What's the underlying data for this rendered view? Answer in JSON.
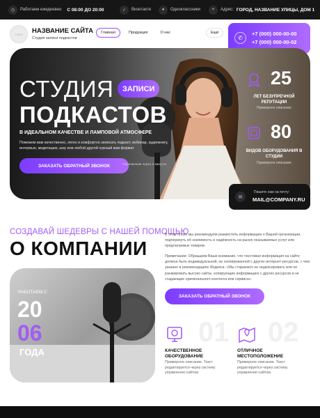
{
  "topbar": {
    "hours_label": "Работаем ежедневно",
    "hours_value": "С 08:00 ДО 20:00",
    "social_1": "Вконтакте",
    "social_2": "Одноклассники",
    "address_label": "Адрес:",
    "address_value": "ГОРОД, НАЗВАНИЕ УЛИЦЫ, ДОМ 1"
  },
  "header": {
    "logo_text": "LOGO",
    "site_title": "НАЗВАНИЕ САЙТА",
    "site_subtitle": "Студия записи подкастов",
    "nav": [
      "Главная",
      "Продукция",
      "О нас"
    ],
    "nav_more": "Ещё",
    "phones": [
      "+7 (000) 000-00-00",
      "+7 (000) 000-00-02"
    ]
  },
  "hero": {
    "title_line1": "СТУДИЯ",
    "title_badge": "ЗАПИСИ",
    "title_line2": "ПОДКАСТОВ",
    "subtitle": "В ИДЕАЛЬНОМ КАЧЕСТВЕ И ЛАМПОВОЙ АТМОСФЕРЕ",
    "description": "Поможем вам качественно, легко и комфортно записать подкаст, вебинар, аудиокнигу, интервью, медитацию, шоу или любой другой нужный вам формат",
    "cta": "ЗАКАЗАТЬ ОБРАТНЫЙ ЗВОНОК",
    "cta_note": "Перезвоним через 2 минуты",
    "stats": [
      {
        "number": "25",
        "title": "ЛЕТ БЕЗУПРЕЧНОЙ\nРЕПУТАЦИИ",
        "desc": "Примерное описание"
      },
      {
        "number": "80",
        "title": "ВИДОВ ОБОРУДОВАНИЯ В\nСТУДИИ",
        "desc": "Примерное описание"
      }
    ],
    "mail_label": "Пишите нам на почту:",
    "mail_value": "MAIL@COMPANY.RU"
  },
  "about": {
    "kicker": "СОЗДАВАЙ ШЕДЕВРЫ С НАШЕЙ ПОМОЩЬЮ",
    "title": "О КОМПАНИИ",
    "paragraph1": "В этом блоке мы рекомендуем разместить информацию о Вашей организации, подчеркнуть её значимость и надёжность на рынке оказываемых услуг или предлагаемых товаров.",
    "paragraph2": "Примечание: Обращаем Ваше внимание, что текстовая информация на сайте должна быть индивидуальной, не скопированной с других интернет-ресурсов, с чем указано в рекомендациях Яндекса: «Мы стараемся не индексировать или не ранжировать высоко сайты, копирующие информацию с других ресурсов и не создающие оригинального контента или сервиса».",
    "cta": "ЗАКАЗАТЬ ОБРАТНЫЙ ЗВОНОК",
    "years_label": "РАБОТАЕМ С",
    "years_num1": "20",
    "years_num2": "06",
    "years_word": "ГОДА",
    "features": [
      {
        "num": "01",
        "title": "КАЧЕСТВЕННОЕ\nОБОРУДОВАНИЕ",
        "desc": "Примерное описание. Текст редактируется через систему управления сайтом."
      },
      {
        "num": "02",
        "title": "ОТЛИЧНОЕ\nМЕСТОПОЛОЖЕНИЕ",
        "desc": "Примерное описание. Текст редактируется через систему управления сайтом."
      }
    ]
  },
  "colors": {
    "accent": "#a25cf5",
    "accent_gradient_start": "#7c3cff",
    "accent_gradient_end": "#b06bff",
    "dark": "#161616"
  }
}
